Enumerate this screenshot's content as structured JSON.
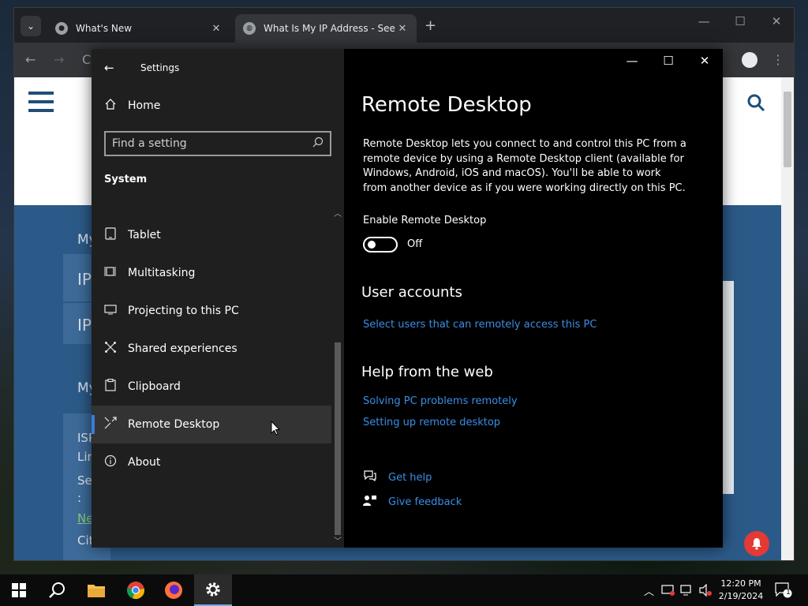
{
  "browser": {
    "tabs": [
      {
        "title": "What's New",
        "active": false
      },
      {
        "title": "What Is My IP Address - See Your",
        "active": true
      }
    ],
    "page_fragments": [
      "My",
      "IP",
      "IP",
      "My",
      "ISP",
      "Lin",
      "Se",
      ":",
      "Ne",
      "Cit"
    ]
  },
  "settings": {
    "window_title": "Settings",
    "home_label": "Home",
    "search_placeholder": "Find a setting",
    "section": "System",
    "nav_items": [
      {
        "label": "Tablet",
        "icon": "tablet-icon"
      },
      {
        "label": "Multitasking",
        "icon": "multitasking-icon"
      },
      {
        "label": "Projecting to this PC",
        "icon": "projecting-icon"
      },
      {
        "label": "Shared experiences",
        "icon": "shared-experiences-icon"
      },
      {
        "label": "Clipboard",
        "icon": "clipboard-icon"
      },
      {
        "label": "Remote Desktop",
        "icon": "remote-desktop-icon",
        "selected": true
      },
      {
        "label": "About",
        "icon": "info-icon"
      }
    ],
    "content": {
      "title": "Remote Desktop",
      "description": "Remote Desktop lets you connect to and control this PC from a remote device by using a Remote Desktop client (available for Windows, Android, iOS and macOS). You'll be able to work from another device as if you were working directly on this PC.",
      "enable_label": "Enable Remote Desktop",
      "toggle_state": "Off",
      "user_accounts_heading": "User accounts",
      "user_accounts_link": "Select users that can remotely access this PC",
      "help_heading": "Help from the web",
      "help_links": [
        "Solving PC problems remotely",
        "Setting up remote desktop"
      ],
      "get_help": "Get help",
      "give_feedback": "Give feedback"
    }
  },
  "taskbar": {
    "time": "12:20 PM",
    "date": "2/19/2024",
    "notification_count": "1"
  },
  "colors": {
    "accent": "#3a7bd5",
    "link": "#3a8ee6"
  }
}
